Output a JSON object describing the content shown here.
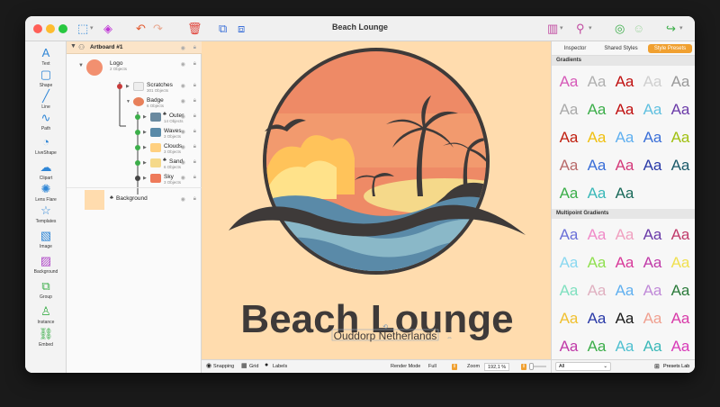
{
  "window": {
    "title": "Beach Lounge"
  },
  "toolbar": {
    "icons": [
      "select-tool-icon",
      "node-tool-icon",
      "undo-icon",
      "redo-icon",
      "delete-icon",
      "group-icon",
      "ungroup-icon",
      "grid-icon",
      "hierarchy-icon",
      "palette-icon",
      "colors-icon",
      "share-icon"
    ]
  },
  "tools": [
    {
      "label": "Text",
      "glyph": "A"
    },
    {
      "label": "Shape",
      "glyph": "▢"
    },
    {
      "label": "Line",
      "glyph": "╱"
    },
    {
      "label": "Path",
      "glyph": "∿"
    },
    {
      "label": "LiveShape",
      "glyph": "◔"
    },
    {
      "label": "Clipart",
      "glyph": "☁"
    },
    {
      "label": "Lens Flare",
      "glyph": "✺"
    },
    {
      "label": "Templates",
      "glyph": "☆"
    },
    {
      "label": "Image",
      "glyph": "▧"
    },
    {
      "label": "Background",
      "glyph": "▨"
    },
    {
      "label": "Group",
      "glyph": "⧉"
    },
    {
      "label": "Instance",
      "glyph": "♙"
    },
    {
      "label": "Embed",
      "glyph": "⛓"
    }
  ],
  "layers": {
    "artboard": "Artboard #1",
    "items": [
      {
        "name": "Logo",
        "sub": "2 Objects"
      },
      {
        "name": "Scratches",
        "sub": "301 Objects"
      },
      {
        "name": "Badge",
        "sub": "6 Objects"
      },
      {
        "name": "Outer",
        "sub": "14 Objects"
      },
      {
        "name": "Waves",
        "sub": "3 Objects"
      },
      {
        "name": "Clouds",
        "sub": "3 Objects"
      },
      {
        "name": "Sand",
        "sub": "6 Objects"
      },
      {
        "name": "Sky",
        "sub": "3 Objects"
      },
      {
        "name": "Background",
        "sub": ""
      }
    ]
  },
  "canvas": {
    "headline": "Beach Lounge",
    "subline": "Ouddorp Netherlands"
  },
  "status": {
    "snapping": "Snapping",
    "grid": "Grid",
    "labels": "Labels",
    "render_mode_label": "Render Mode",
    "render_mode_value": "Full",
    "zoom_label": "Zoom",
    "zoom_value": "192,1 %"
  },
  "inspector": {
    "tabs": [
      "Inspector",
      "Shared Styles",
      "Style Presets"
    ],
    "gradients_header": "Gradients",
    "multipoint_header": "Multipoint Gradients",
    "filter_value": "All",
    "presets_lab": "Presets Lab",
    "cell_text": "Aa"
  },
  "colors": {
    "accent": "#f0a030",
    "canvas_bg": "#ffdcae",
    "text_dark": "#3e3a39"
  }
}
